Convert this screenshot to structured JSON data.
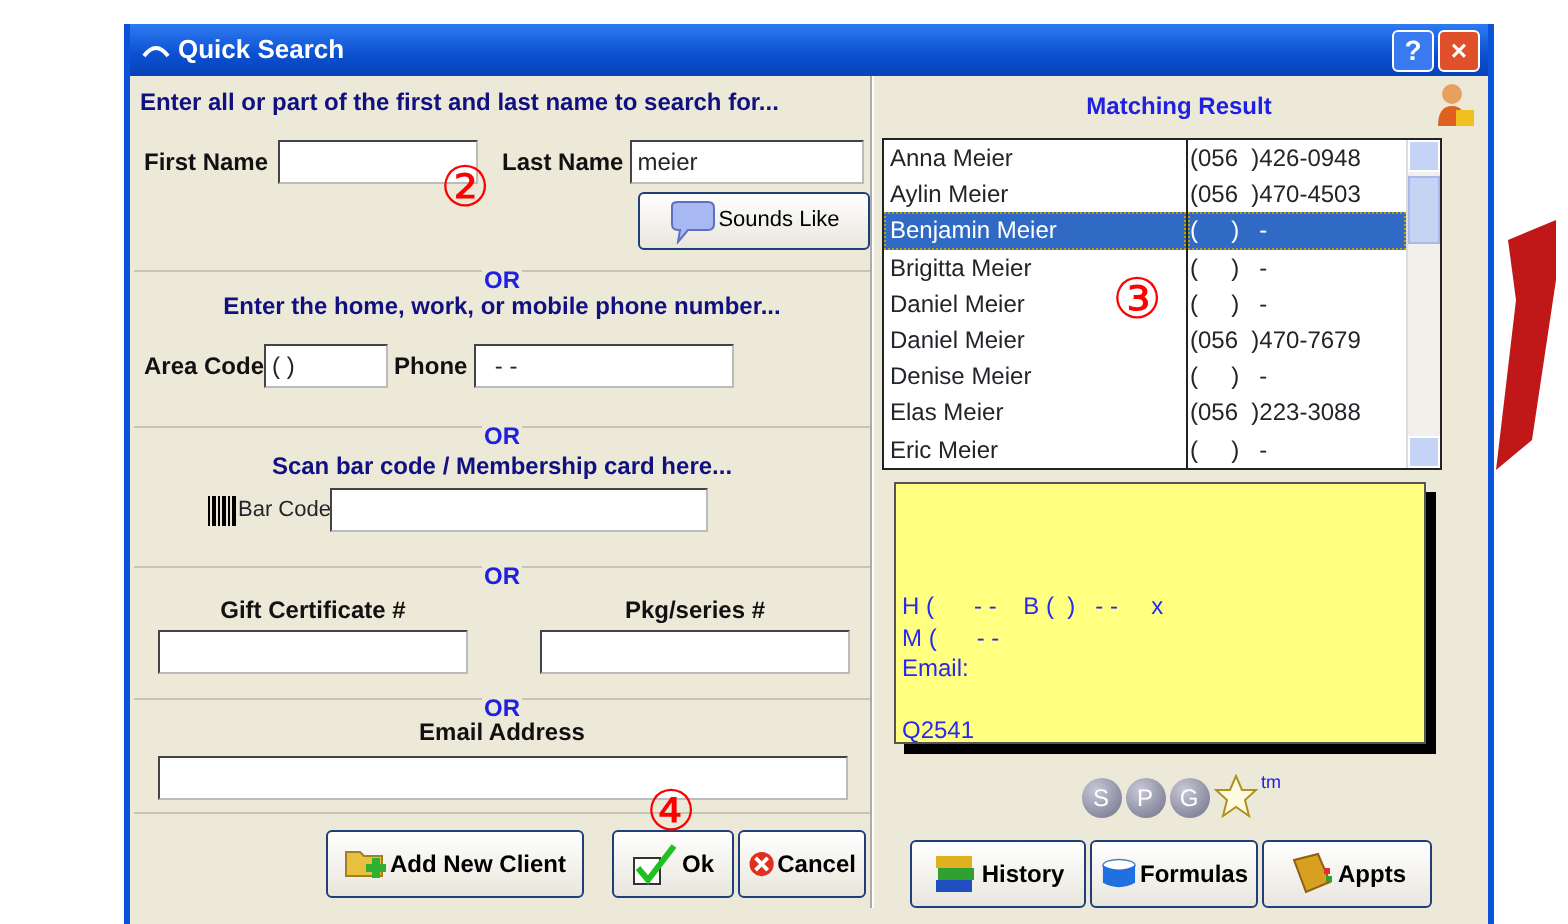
{
  "window": {
    "title": "Quick Search",
    "help_button": "?",
    "close_button": "×"
  },
  "name_search": {
    "heading": "Enter all or part of the first and last name to search for...",
    "first_name_label": "First Name",
    "last_name_label": "Last Name",
    "last_name_value": "meier",
    "sounds_like_button": "Sounds Like"
  },
  "phone_search": {
    "separator": "OR",
    "heading": "Enter the home, work, or mobile phone number...",
    "area_code_label": "Area Code",
    "area_code_value": "( )",
    "phone_label": "Phone",
    "phone_value": "  - -"
  },
  "barcode_search": {
    "separator": "OR",
    "heading": "Scan bar code / Membership card here...",
    "bar_code_label": "Bar Code"
  },
  "certificate_search": {
    "separator": "OR",
    "gift_label": "Gift Certificate #",
    "package_label": "Pkg/series #"
  },
  "email_search": {
    "separator": "OR",
    "email_label": "Email Address"
  },
  "left_buttons": [
    {
      "label": "Add New Client",
      "kind": "add"
    },
    {
      "label": "Ok",
      "kind": "ok"
    },
    {
      "label": "Cancel",
      "kind": "cancel"
    }
  ],
  "results": {
    "title": "Matching Result",
    "rows": [
      {
        "name": "Anna Meier",
        "phone": "(056  )426-0948",
        "selected": false
      },
      {
        "name": "Aylin Meier",
        "phone": "(056  )470-4503",
        "selected": false
      },
      {
        "name": "Benjamin Meier",
        "phone": "(     )   -",
        "selected": true
      },
      {
        "name": "Brigitta Meier",
        "phone": "(     )   -",
        "selected": false
      },
      {
        "name": "Daniel Meier",
        "phone": "(     )   -",
        "selected": false
      },
      {
        "name": "Daniel Meier",
        "phone": "(056  )470-7679",
        "selected": false
      },
      {
        "name": "Denise Meier",
        "phone": "(     )   -",
        "selected": false
      },
      {
        "name": "Elas Meier",
        "phone": "(056  )223-3088",
        "selected": false
      },
      {
        "name": "Eric Meier",
        "phone": "(     )   -",
        "selected": false
      }
    ]
  },
  "note": {
    "lines": [
      "H (      - -    B (  )   - -     x",
      "M (      - -",
      "Email:"
    ],
    "code": "Q2541"
  },
  "badges": [
    "S",
    "P",
    "G"
  ],
  "trademark": "tm",
  "right_buttons": [
    {
      "label": "History",
      "kind": "history"
    },
    {
      "label": "Formulas",
      "kind": "formulas"
    },
    {
      "label": "Appts",
      "kind": "appts"
    }
  ],
  "callouts": [
    "②",
    "③",
    "④"
  ]
}
